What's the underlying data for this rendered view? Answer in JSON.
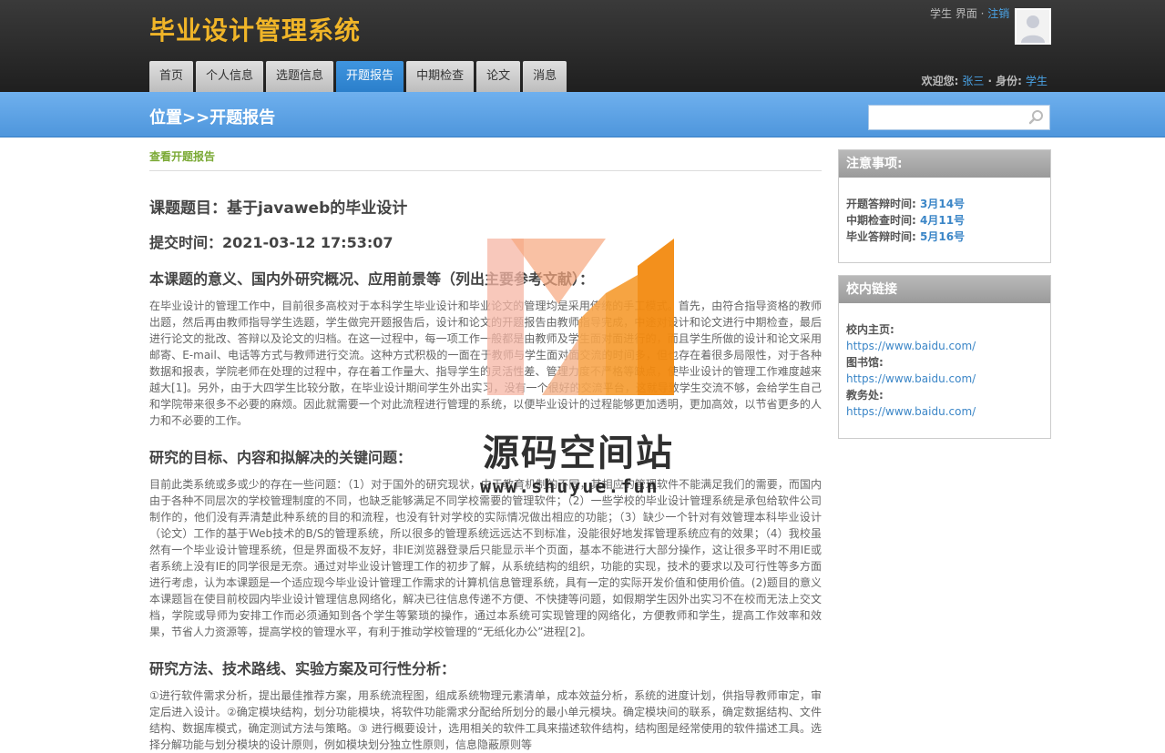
{
  "header": {
    "site_title": "毕业设计管理系统",
    "top_links": {
      "role": "学生",
      "sep1": " 界面 · ",
      "logout": "注销"
    },
    "welcome": {
      "label_welcome": "欢迎您:",
      "user": "张三",
      "label_role": "· 身份:",
      "role": "学生"
    }
  },
  "nav": {
    "items": [
      {
        "label": "首页"
      },
      {
        "label": "个人信息"
      },
      {
        "label": "选题信息"
      },
      {
        "label": "开题报告"
      },
      {
        "label": "中期检查"
      },
      {
        "label": "论文"
      },
      {
        "label": "消息"
      }
    ],
    "active_index": 3
  },
  "band": {
    "title": "位置>>开题报告",
    "search_placeholder": ""
  },
  "main": {
    "sub_link": "查看开题报告",
    "topic": "课题题目：基于javaweb的毕业设计",
    "submit_time": "提交时间：2021-03-12 17:53:07",
    "sections": [
      {
        "title": "本课题的意义、国内外研究概况、应用前景等（列出主要参考文献）：",
        "body": "在毕业设计的管理工作中，目前很多高校对于本科学生毕业设计和毕业论文的管理均是采用传统的手工模式。首先，由符合指导资格的教师出题，然后再由教师指导学生选题，学生做完开题报告后，设计和论文的开题报告由教师指导完成，中途对设计和论文进行中期检查，最后进行论文的批改、答辩以及论文的归档。在这一过程中，每一项工作一般都是由教师及学生面对面进行的，而且学生所做的设计和论文采用邮寄、E-mail、电话等方式与教师进行交流。这种方式积极的一面在于教师与学生面对面交流的时间多，但也存在着很多局限性，对于各种数据和报表，学院老师在处理的过程中，存在着工作量大、指导学生的灵活性差、管理力度不严格等缺点，使毕业设计的管理工作难度越来越大[1]。另外，由于大四学生比较分散，在毕业设计期间学生外出实习，没有一个很好的交流平台，这就导致学生交流不够，会给学生自己和学院带来很多不必要的麻烦。因此就需要一个对此流程进行管理的系统，以便毕业设计的过程能够更加透明，更加高效，以节省更多的人力和不必要的工作。"
      },
      {
        "title": "研究的目标、内容和拟解决的关键问题：",
        "body": "目前此类系统或多或少的存在一些问题：（1）对于国外的研究现状，由于教育机制的不同，其相应的管理软件不能满足我们的需要，而国内由于各种不同层次的学校管理制度的不同，也缺乏能够满足不同学校需要的管理软件；（2）一些学校的毕业设计管理系统是承包给软件公司制作的，他们没有弄清楚此种系统的目的和流程，也没有针对学校的实际情况做出相应的功能；（3）缺少一个针对有效管理本科毕业设计（论文）工作的基于Web技术的B/S的管理系统，所以很多的管理系统远远达不到标准，没能很好地发挥管理系统应有的效果；（4）我校虽然有一个毕业设计管理系统，但是界面极不友好，非IE浏览器登录后只能显示半个页面，基本不能进行大部分操作，这让很多平时不用IE或者系统上没有IE的同学很是无奈。通过对毕业设计管理工作的初步了解，从系统结构的组织，功能的实现，技术的要求以及可行性等多方面进行考虑，认为本课题是一个适应现今毕业设计管理工作需求的计算机信息管理系统，具有一定的实际开发价值和使用价值。(2)题目的意义 本课题旨在使目前校园内毕业设计管理信息网络化，解决已往信息传递不方便、不快捷等问题，如假期学生因外出实习不在校而无法上交文档，学院或导师为安排工作而必须通知到各个学生等繁琐的操作，通过本系统可实现管理的网络化，方便教师和学生，提高工作效率和效果，节省人力资源等，提高学校的管理水平，有利于推动学校管理的“无纸化办公”进程[2]。"
      },
      {
        "title": "研究方法、技术路线、实验方案及可行性分析：",
        "body": "①进行软件需求分析，提出最佳推荐方案，用系统流程图，组成系统物理元素清单，成本效益分析，系统的进度计划，供指导教师审定，审定后进入设计。②确定模块结构，划分功能模块，将软件功能需求分配给所划分的最小单元模块。确定模块间的联系，确定数据结构、文件结构、数据库模式，确定测试方法与策略。③ 进行概要设计，选用相关的软件工具来描述软件结构，结构图是经常使用的软件描述工具。选择分解功能与划分模块的设计原则，例如模块划分独立性原则，信息隐蔽原则等"
      }
    ]
  },
  "sidebar": {
    "notice": {
      "title": "注意事项:",
      "items": [
        {
          "label": "开题答辩时间:",
          "value": "3月14号"
        },
        {
          "label": "中期检查时间:",
          "value": "4月11号"
        },
        {
          "label": "毕业答辩时间:",
          "value": "5月16号"
        }
      ]
    },
    "links": {
      "title": "校内链接",
      "items": [
        {
          "label": "校内主页:",
          "url": "https://www.baidu.com/"
        },
        {
          "label": "图书馆:",
          "url": "https://www.baidu.com/"
        },
        {
          "label": "教务处:",
          "url": "https://www.baidu.com/"
        }
      ]
    }
  },
  "watermark": {
    "text": "源码空间站",
    "url": "www.shuyue.fun"
  },
  "colors": {
    "title_gold": "#f0b528",
    "nav_active": "#3a8fdb",
    "band_blue": "#5aa2e4",
    "link_blue": "#3b86c7",
    "sub_link_green": "#7aa934"
  }
}
